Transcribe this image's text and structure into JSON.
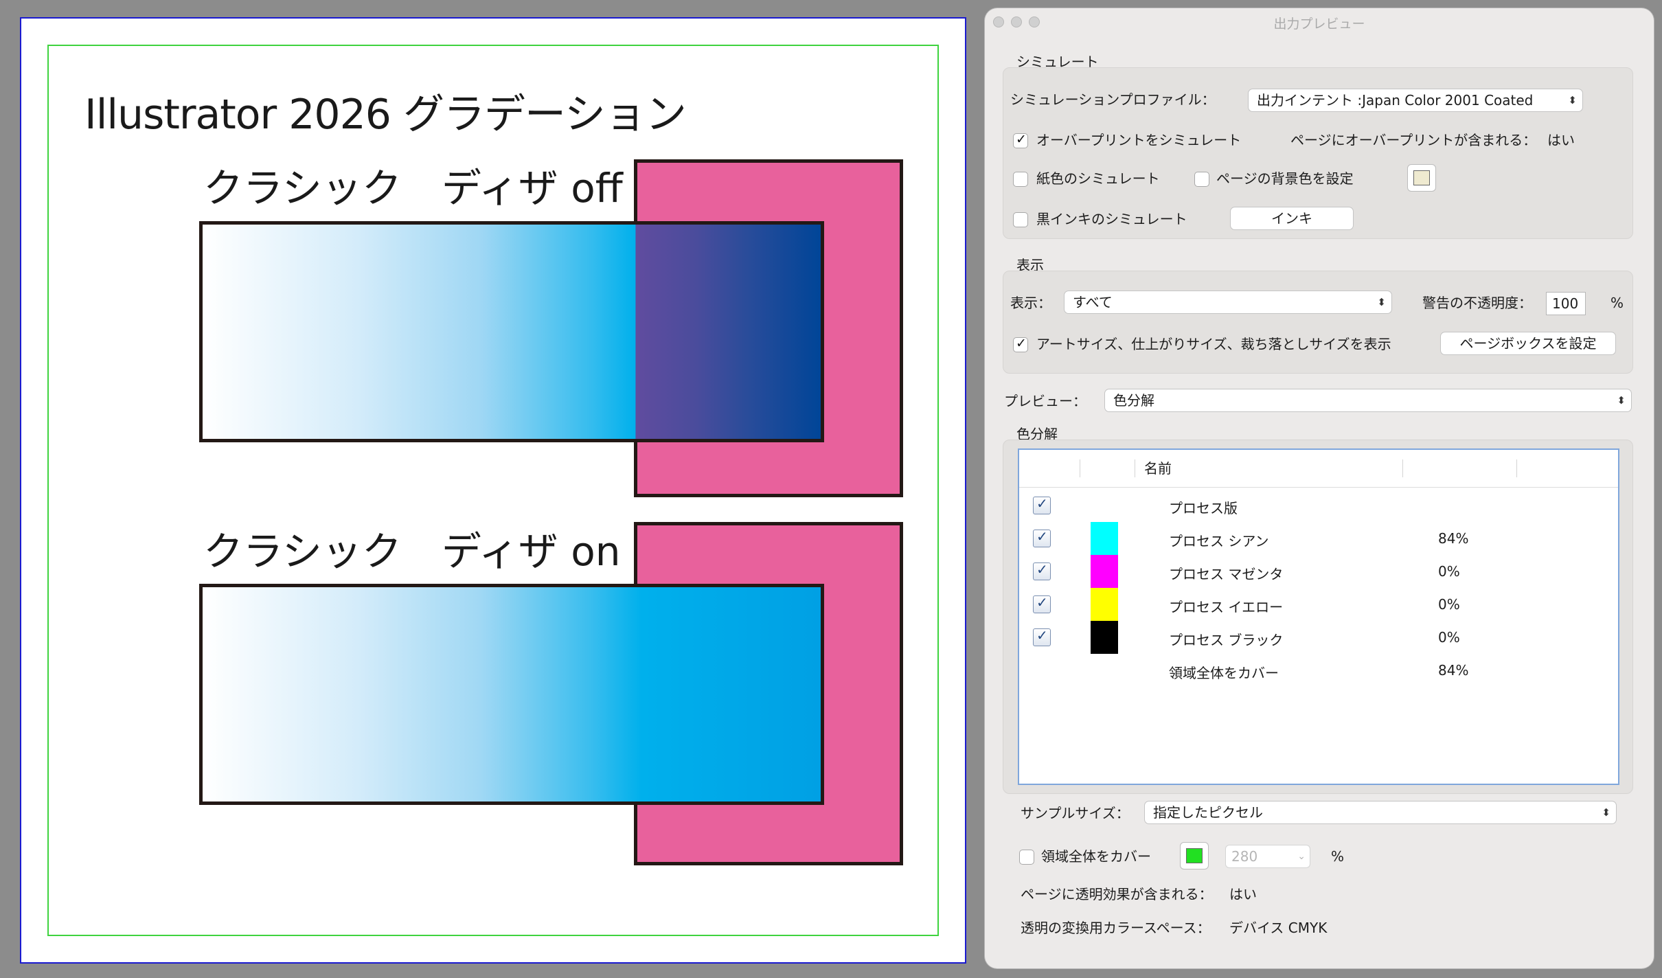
{
  "artboard": {
    "title": "Illustrator 2026 グラデーション",
    "label_off": "クラシック　ディザ off",
    "label_on": "クラシック　ディザ on"
  },
  "panel": {
    "title": "出力プレビュー",
    "simulate": {
      "section": "シミュレート",
      "profile_label": "シミュレーションプロファイル：",
      "profile_value": "出力インテント :Japan Color 2001 Coated",
      "overprint_label": "オーバープリントをシミュレート",
      "overprint_checked": true,
      "page_overprint_label": "ページにオーバープリントが含まれる：",
      "page_overprint_value": "はい",
      "paper_color_label": "紙色のシミュレート",
      "paper_color_checked": false,
      "page_bg_label": "ページの背景色を設定",
      "page_bg_checked": false,
      "page_bg_color": "#efead0",
      "black_ink_label": "黒インキのシミュレート",
      "black_ink_checked": false,
      "ink_button": "インキ"
    },
    "display": {
      "section": "表示",
      "show_label": "表示：",
      "show_value": "すべて",
      "warn_label": "警告の不透明度：",
      "warn_value": "100",
      "warn_unit": "%",
      "artsize_label": "アートサイズ、仕上がりサイズ、裁ち落としサイズを表示",
      "artsize_checked": true,
      "pagebox_button": "ページボックスを設定"
    },
    "preview": {
      "label": "プレビュー：",
      "value": "色分解"
    },
    "separations": {
      "section": "色分解",
      "header_name": "名前",
      "rows": [
        {
          "name": "プロセス版",
          "percent": "",
          "color": "",
          "checked": true
        },
        {
          "name": "プロセス シアン",
          "percent": "84%",
          "color": "#00ffff",
          "checked": true
        },
        {
          "name": "プロセス マゼンタ",
          "percent": "0%",
          "color": "#ff00ff",
          "checked": true
        },
        {
          "name": "プロセス イエロー",
          "percent": "0%",
          "color": "#ffff00",
          "checked": true
        },
        {
          "name": "プロセス ブラック",
          "percent": "0%",
          "color": "#000000",
          "checked": true
        },
        {
          "name": "領域全体をカバー",
          "percent": "84%",
          "color": "",
          "checked": false
        }
      ]
    },
    "sample": {
      "label": "サンプルサイズ：",
      "value": "指定したピクセル"
    },
    "coverage": {
      "label": "領域全体をカバー",
      "checked": false,
      "color": "#22e022",
      "value": "280",
      "unit": "%"
    },
    "transparency": {
      "label": "ページに透明効果が含まれる：",
      "value": "はい"
    },
    "colorspace": {
      "label": "透明の変換用カラースペース：",
      "value": "デバイス CMYK"
    }
  }
}
